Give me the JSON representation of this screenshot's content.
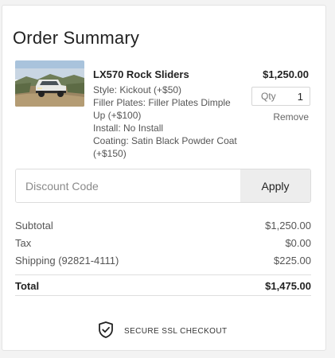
{
  "summary": {
    "title": "Order Summary"
  },
  "item": {
    "name": "LX570 Rock Sliders",
    "price": "$1,250.00",
    "options": [
      "Style: Kickout (+$50)",
      "Filler Plates: Filler Plates Dimple Up (+$100)",
      "Install: No Install",
      "Coating: Satin Black Powder Coat (+$150)"
    ],
    "qty_label": "Qty",
    "qty_value": "1",
    "remove_label": "Remove"
  },
  "discount": {
    "placeholder": "Discount Code",
    "apply_label": "Apply"
  },
  "totals": {
    "subtotal_label": "Subtotal",
    "subtotal_value": "$1,250.00",
    "tax_label": "Tax",
    "tax_value": "$0.00",
    "shipping_label": "Shipping (92821-4111)",
    "shipping_value": "$225.00",
    "total_label": "Total",
    "total_value": "$1,475.00"
  },
  "secure": {
    "label": "SECURE SSL CHECKOUT",
    "icon": "shield-check-icon"
  }
}
